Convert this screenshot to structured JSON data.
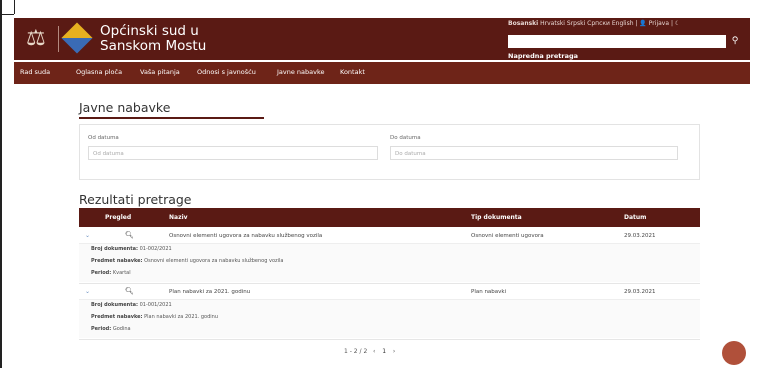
{
  "header": {
    "court_name_line1": "Općinski sud u",
    "court_name_line2": "Sanskom Mostu",
    "languages": [
      "Bosanski",
      "Hrvatski",
      "Srpski",
      "Српски",
      "English"
    ],
    "login_label": "Prijava",
    "search_placeholder": "",
    "advanced_search": "Napredna pretraga"
  },
  "nav": {
    "items": [
      "Rad suda",
      "Oglasna ploča",
      "Vaša pitanja",
      "Odnosi s javnošću",
      "Javne nabavke",
      "Kontakt"
    ]
  },
  "page": {
    "title": "Javne nabavke"
  },
  "filters": {
    "from_label": "Od datuma",
    "from_placeholder": "Od datuma",
    "to_label": "Do datuma",
    "to_placeholder": "Do datuma"
  },
  "results": {
    "title": "Rezultati pretrage",
    "columns": [
      "Pregled",
      "Naziv",
      "Tip dokumenta",
      "Datum"
    ],
    "rows": [
      {
        "naziv": "Osnovni elementi ugovora za nabavku službenog vozila",
        "tip": "Osnovni elementi ugovora",
        "datum": "29.03.2021",
        "broj_label": "Broj dokumenta:",
        "broj": "01-002/2021",
        "predmet_label": "Predmet nabavke:",
        "predmet": "Osnovni elementi ugovora za nabavku službenog vozila",
        "period_label": "Period:",
        "period": "Kvartal"
      },
      {
        "naziv": "Plan nabavki za 2021. godinu",
        "tip": "Plan nabavki",
        "datum": "29.03.2021",
        "broj_label": "Broj dokumenta:",
        "broj": "01-001/2021",
        "predmet_label": "Predmet nabavke:",
        "predmet": "Plan nabavki za 2021. godinu",
        "period_label": "Period:",
        "period": "Godina"
      }
    ]
  },
  "pager": {
    "range": "1 - 2 / 2",
    "current": "1",
    "prev_icon": "‹",
    "next_icon": "›"
  },
  "colors": {
    "brand": "#5a1a14",
    "nav": "#6e2418",
    "chat": "#b0503a"
  }
}
